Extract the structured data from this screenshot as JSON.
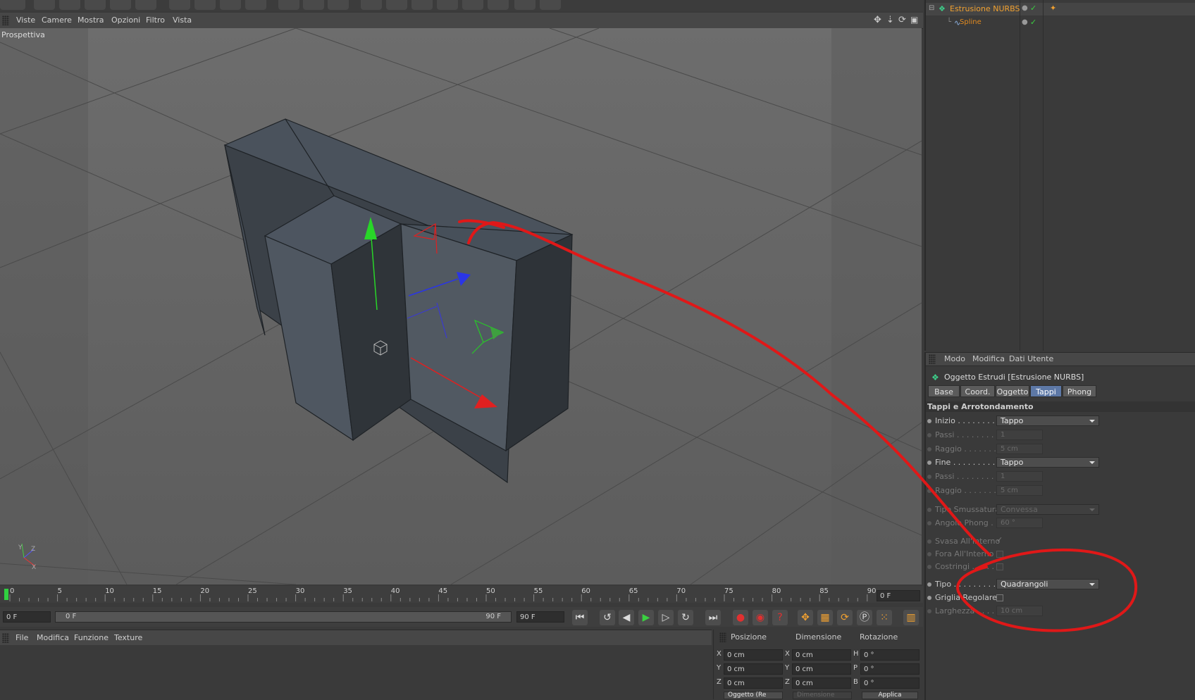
{
  "viewport_menu": [
    "Viste",
    "Camere",
    "Mostra",
    "Opzioni",
    "Filtro",
    "Vista"
  ],
  "viewport_label": "Prospettiva",
  "timeline": {
    "ticks": [
      "0",
      "5",
      "10",
      "15",
      "20",
      "25",
      "30",
      "35",
      "40",
      "45",
      "50",
      "55",
      "60",
      "65",
      "70",
      "75",
      "80",
      "85",
      "90"
    ],
    "current_frame_right": "0 F",
    "start_field": "0 F",
    "range_start": "0 F",
    "range_end": "90 F",
    "end_field": "90 F"
  },
  "material_menu": [
    "File",
    "Modifica",
    "Funzione",
    "Texture"
  ],
  "coordinates": {
    "headers": [
      "Posizione",
      "Dimensione",
      "Rotazione"
    ],
    "rows": [
      {
        "a": "X",
        "pos": "0 cm",
        "b": "X",
        "dim": "0 cm",
        "c": "H",
        "rot": "0 °"
      },
      {
        "a": "Y",
        "pos": "0 cm",
        "b": "Y",
        "dim": "0 cm",
        "c": "P",
        "rot": "0 °"
      },
      {
        "a": "Z",
        "pos": "0 cm",
        "b": "Z",
        "dim": "0 cm",
        "c": "B",
        "rot": "0 °"
      }
    ],
    "mode_select": "Oggetto (Re",
    "size_select": "Dimensione",
    "apply_button": "Applica"
  },
  "object_manager": {
    "items": [
      {
        "name": "Estrusione NURBS",
        "color": "#f0a030"
      },
      {
        "name": "Spline",
        "color": "#e08a20"
      }
    ]
  },
  "attributes": {
    "menu": [
      "Modo",
      "Modifica",
      "Dati Utente"
    ],
    "object_title": "Oggetto Estrudi [Estrusione NURBS]",
    "tabs": [
      "Base",
      "Coord.",
      "Oggetto",
      "Tappi",
      "Phong"
    ],
    "active_tab": "Tappi",
    "section_title": "Tappi e Arrotondamento",
    "props": {
      "inizio_label": "Inizio . . . . . . . . .",
      "inizio_value": "Tappo",
      "passi1_label": "Passi . . . . . . . . .",
      "passi1_value": "1",
      "raggio1_label": "Raggio . . . . . . . .",
      "raggio1_value": "5 cm",
      "fine_label": "Fine . . . . . . . . . .",
      "fine_value": "Tappo",
      "passi2_label": "Passi . . . . . . . . .",
      "passi2_value": "1",
      "raggio2_label": "Raggio . . . . . . . .",
      "raggio2_value": "5 cm",
      "tipo_smussatura_label": "Tipo Smussatura",
      "tipo_smussatura_value": "Convessa",
      "angolo_phong_label": "Angolo Phong . .",
      "angolo_phong_value": "60 °",
      "svasa_label": "Svasa All'Interno",
      "fora_label": "Fora All'Interno",
      "costringi_label": "Costringi . . . . .",
      "tipo_label": "Tipo . . . . . . . . .",
      "tipo_value": "Quadrangoli",
      "griglia_label": "Griglia Regolare",
      "larghezza_label": "Larghezza . . . .",
      "larghezza_value": "10 cm"
    }
  },
  "colors": {
    "annotation_red": "#e01818",
    "active_tab": "#5d78a6",
    "object_orange": "#f0a030"
  }
}
